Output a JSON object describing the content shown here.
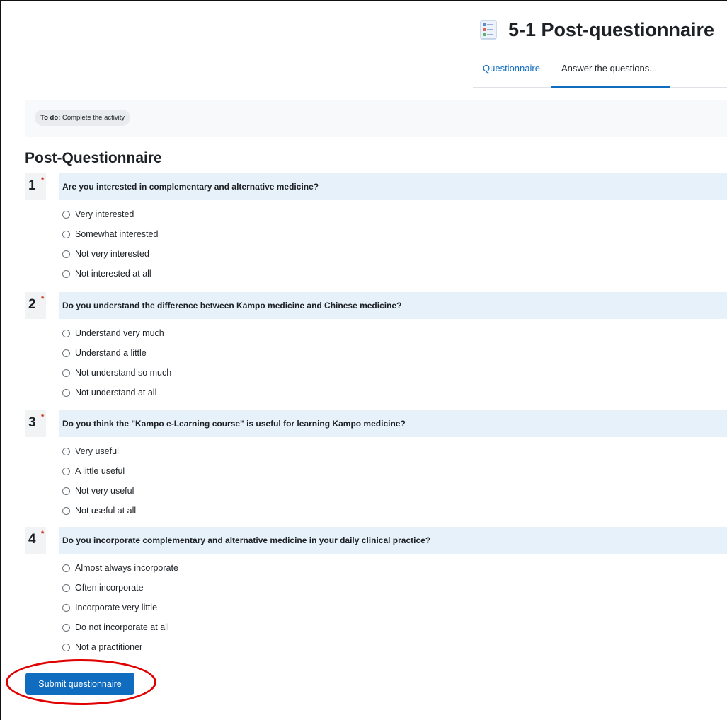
{
  "header": {
    "title": "5-1 Post-questionnaire",
    "icon": "questionnaire-icon"
  },
  "tabs": [
    {
      "label": "Questionnaire",
      "active": false
    },
    {
      "label": "Answer the questions...",
      "active": true
    }
  ],
  "todo": {
    "label": "To do:",
    "text": "Complete the activity"
  },
  "page_heading": "Post-Questionnaire",
  "questions": [
    {
      "number": "1",
      "required_mark": "*",
      "text": "Are you interested in complementary and alternative medicine?",
      "options": [
        "Very interested",
        "Somewhat interested",
        "Not very interested",
        "Not interested at all"
      ]
    },
    {
      "number": "2",
      "required_mark": "*",
      "text": "Do you understand the difference between Kampo medicine and Chinese medicine?",
      "options": [
        "Understand very much",
        "Understand a little",
        "Not understand so much",
        "Not understand at all"
      ]
    },
    {
      "number": "3",
      "required_mark": "*",
      "text": "Do you think the \"Kampo e-Learning course\" is useful for learning Kampo medicine?",
      "options": [
        "Very useful",
        "A little useful",
        "Not very useful",
        "Not useful at all"
      ]
    },
    {
      "number": "4",
      "required_mark": "*",
      "text": "Do you incorporate complementary and alternative medicine in your daily clinical practice?",
      "options": [
        "Almost always incorporate",
        "Often incorporate",
        "Incorporate very little",
        "Do not incorporate at all",
        "Not a practitioner"
      ]
    }
  ],
  "submit_label": "Submit questionnaire",
  "colors": {
    "accent": "#0f6cbf",
    "required": "#ca3120",
    "question_bar": "#e7f1fa",
    "highlight": "#e00000"
  }
}
